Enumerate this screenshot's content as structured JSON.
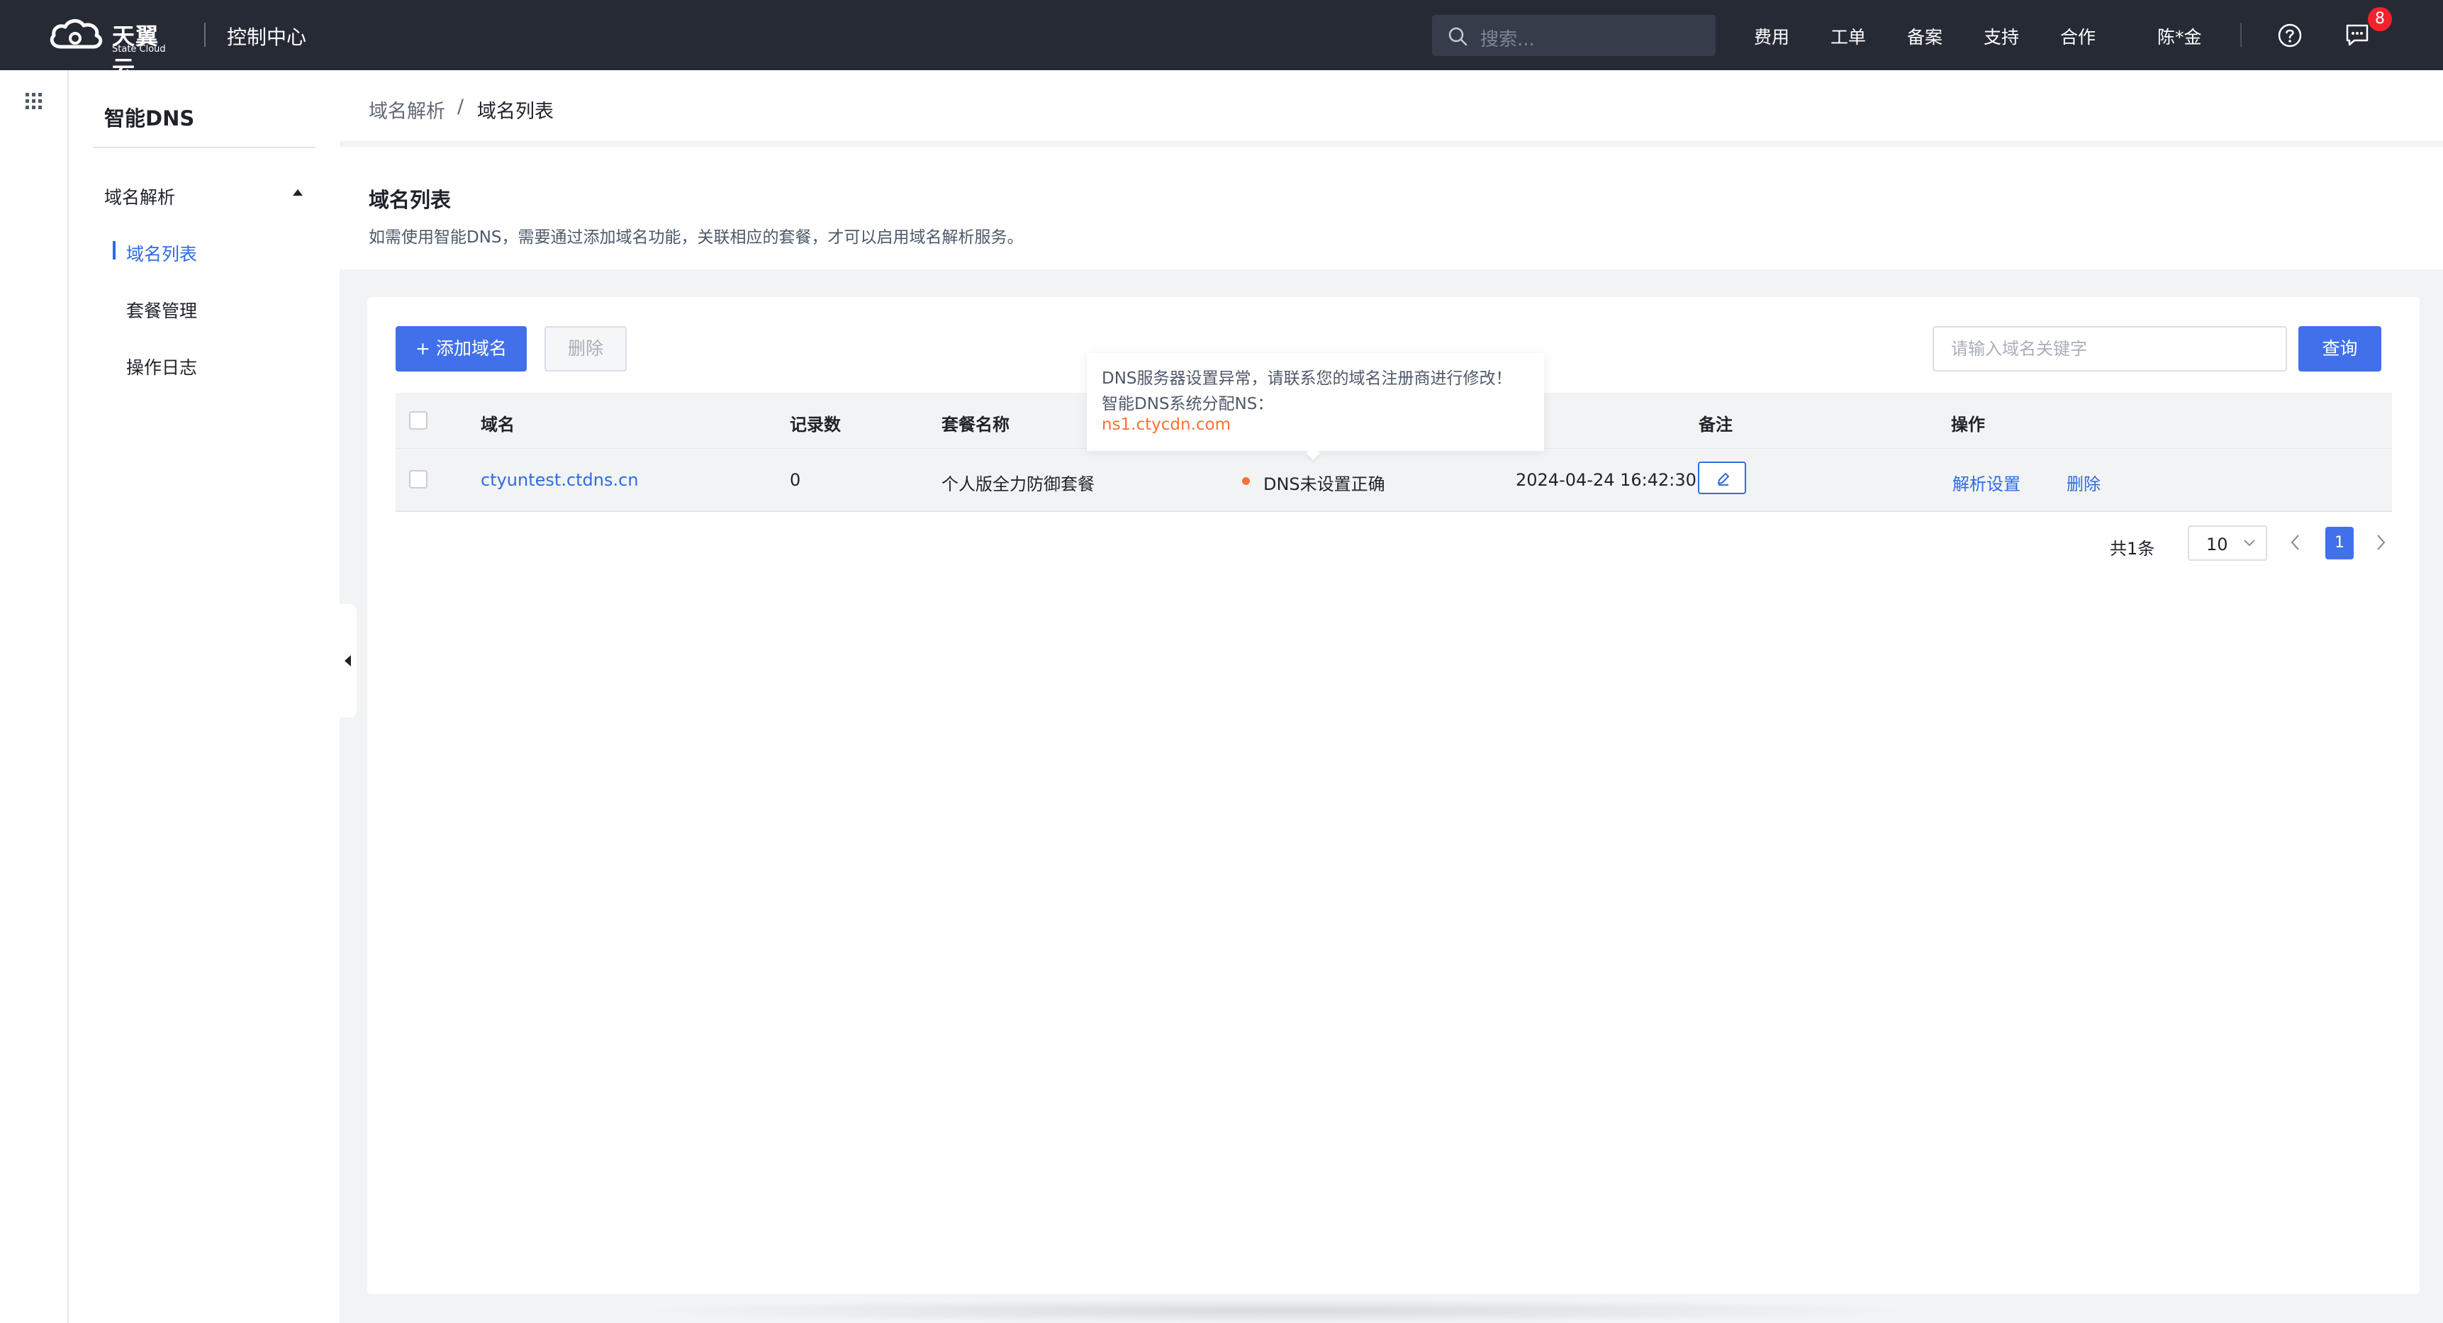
{
  "topbar": {
    "brand_name": "天翼云",
    "brand_sub": "State Cloud",
    "console_title": "控制中心",
    "search_placeholder": "搜索...",
    "nav": [
      "费用",
      "工单",
      "备案",
      "支持",
      "合作"
    ],
    "user_name": "陈*金",
    "message_count": "8",
    "icons": [
      "search-icon",
      "help-icon",
      "message-icon",
      "grid-icon"
    ]
  },
  "sidebar": {
    "title": "智能DNS",
    "group_label": "域名解析",
    "items": [
      {
        "label": "域名列表",
        "active": true
      },
      {
        "label": "套餐管理",
        "active": false
      },
      {
        "label": "操作日志",
        "active": false
      }
    ]
  },
  "breadcrumb": {
    "parent": "域名解析",
    "separator": "/",
    "current": "域名列表"
  },
  "header": {
    "title": "域名列表",
    "description": "如需使用智能DNS，需要通过添加域名功能，关联相应的套餐，才可以启用域名解析服务。"
  },
  "toolbar": {
    "add_label": "+ 添加域名",
    "delete_label": "删除",
    "keyword_placeholder": "请输入域名关键字",
    "query_label": "查询"
  },
  "table": {
    "columns": [
      "域名",
      "记录数",
      "套餐名称",
      "备注",
      "操作"
    ],
    "rows": [
      {
        "domain": "ctyuntest.ctdns.cn",
        "records": "0",
        "package": "个人版全力防御套餐",
        "status": "DNS未设置正确",
        "created": "2024-04-24 16:42:30",
        "actions": [
          "解析设置",
          "删除"
        ]
      }
    ]
  },
  "tooltip": {
    "line1": "DNS服务器设置异常，请联系您的域名注册商进行修改！",
    "line2": "智能DNS系统分配NS：",
    "ns": "ns1.ctycdn.com"
  },
  "pagination": {
    "total": "共1条",
    "page_size": "10",
    "current_page": "1"
  },
  "colors": {
    "topbar_bg": "#262a35",
    "primary": "#4170ea",
    "link": "#2e6be6",
    "warning": "#f77234",
    "badge": "#f5222d"
  }
}
